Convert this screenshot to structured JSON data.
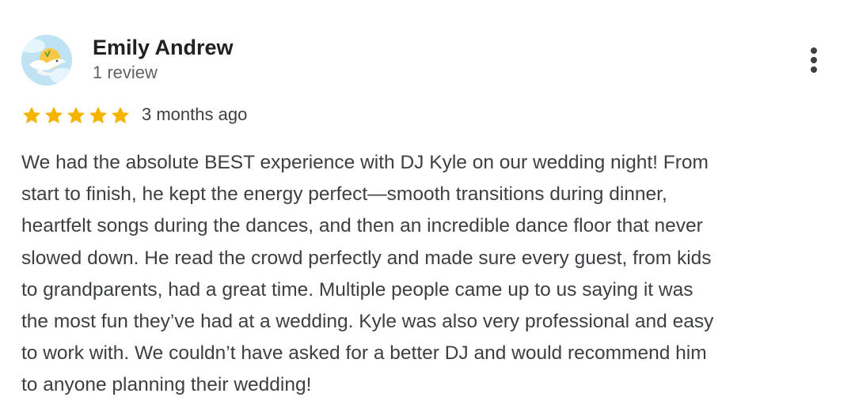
{
  "review": {
    "author_name": "Emily Andrew",
    "review_count": "1 review",
    "rating": 5,
    "max_rating": 5,
    "date": "3 months ago",
    "text_lines": [
      "We had the absolute BEST experience with DJ Kyle on our wedding night! From",
      "start to finish, he kept the energy perfect—smooth transitions during dinner,",
      "heartfelt songs during the dances, and then an incredible dance floor that never",
      "slowed down. He read the crowd perfectly and made sure every guest, from kids",
      "to grandparents, had a great time. Multiple people came up to us saying it was",
      "the most fun they’ve had at a wedding. Kyle was also very professional and easy",
      "to work with. We couldn’t have asked for a better DJ and would recommend him",
      "to anyone planning their wedding!"
    ]
  },
  "icons": {
    "avatar": "dove-avatar-icon",
    "menu": "more-vert-icon",
    "star": "star-icon"
  },
  "colors": {
    "star": "#f4b400",
    "name": "#202124",
    "secondary": "#5f6368",
    "text": "#3c4043",
    "avatar_bg": "#bfe3f2"
  }
}
